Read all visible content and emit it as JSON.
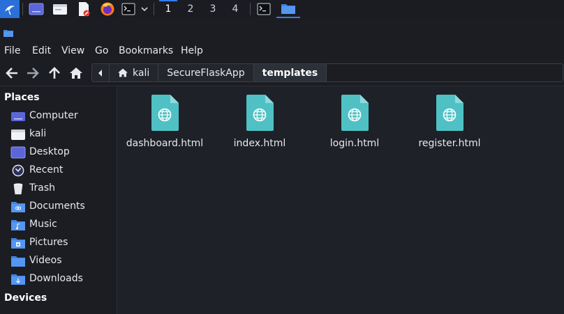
{
  "taskbar": {
    "workspaces": [
      "1",
      "2",
      "3",
      "4"
    ],
    "active_workspace": "1",
    "icons": [
      "kali-dragon-icon",
      "desktop-icon",
      "file-manager-icon",
      "text-editor-icon",
      "firefox-icon",
      "terminal-icon",
      "chevron-down-icon",
      "terminal-task-icon",
      "file-manager-task-icon"
    ]
  },
  "menubar": {
    "items": [
      "File",
      "Edit",
      "View",
      "Go",
      "Bookmarks",
      "Help"
    ]
  },
  "breadcrumb": {
    "items": [
      "kali",
      "SecureFlaskApp",
      "templates"
    ],
    "current": "templates"
  },
  "sidebar": {
    "places_heading": "Places",
    "places": [
      {
        "label": "Computer",
        "icon": "computer-icon"
      },
      {
        "label": "kali",
        "icon": "home-folder-icon"
      },
      {
        "label": "Desktop",
        "icon": "desktop-folder-icon"
      },
      {
        "label": "Recent",
        "icon": "recent-icon"
      },
      {
        "label": "Trash",
        "icon": "trash-icon"
      },
      {
        "label": "Documents",
        "icon": "documents-folder-icon"
      },
      {
        "label": "Music",
        "icon": "music-folder-icon"
      },
      {
        "label": "Pictures",
        "icon": "pictures-folder-icon"
      },
      {
        "label": "Videos",
        "icon": "videos-folder-icon"
      },
      {
        "label": "Downloads",
        "icon": "downloads-folder-icon"
      }
    ],
    "devices_heading": "Devices"
  },
  "files": [
    {
      "name": "dashboard.html",
      "icon": "html-file-icon"
    },
    {
      "name": "index.html",
      "icon": "html-file-icon"
    },
    {
      "name": "login.html",
      "icon": "html-file-icon"
    },
    {
      "name": "register.html",
      "icon": "html-file-icon"
    }
  ],
  "colors": {
    "accent": "#367bf0",
    "file_icon": "#4fc1c5",
    "folder": "#3e83e6",
    "background": "#1e2127"
  }
}
